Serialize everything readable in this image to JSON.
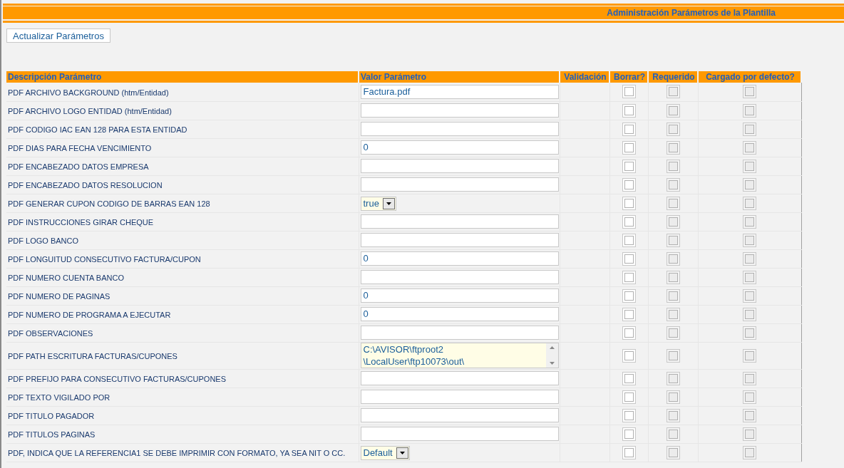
{
  "header": {
    "title": "Administración Parámetros de la Plantilla"
  },
  "update_button": {
    "label": "Actualizar Parámetros"
  },
  "table": {
    "columns": [
      "Descripción Parámetro",
      "Valor Parámetro",
      "Validación",
      "Borrar?",
      "Requerido",
      "Cargado por defecto?"
    ],
    "rows": [
      {
        "description": "PDF ARCHIVO BACKGROUND (htm/Entidad)",
        "kind": "text",
        "value": "Factura.pdf",
        "delete": {
          "checked": false,
          "disabled": false
        },
        "required": {
          "checked": false,
          "disabled": true
        },
        "default": {
          "checked": false,
          "disabled": true
        }
      },
      {
        "description": "PDF ARCHIVO LOGO ENTIDAD (htm/Entidad)",
        "kind": "text",
        "value": "",
        "delete": {
          "checked": false,
          "disabled": false
        },
        "required": {
          "checked": false,
          "disabled": true
        },
        "default": {
          "checked": false,
          "disabled": true
        }
      },
      {
        "description": "PDF CODIGO IAC EAN 128 PARA ESTA ENTIDAD",
        "kind": "text",
        "value": "",
        "delete": {
          "checked": false,
          "disabled": false
        },
        "required": {
          "checked": false,
          "disabled": true
        },
        "default": {
          "checked": false,
          "disabled": true
        }
      },
      {
        "description": "PDF DIAS PARA FECHA VENCIMIENTO",
        "kind": "text",
        "value": "0",
        "delete": {
          "checked": false,
          "disabled": false
        },
        "required": {
          "checked": false,
          "disabled": true
        },
        "default": {
          "checked": false,
          "disabled": true
        }
      },
      {
        "description": "PDF ENCABEZADO DATOS EMPRESA",
        "kind": "text",
        "value": "",
        "delete": {
          "checked": false,
          "disabled": false
        },
        "required": {
          "checked": false,
          "disabled": true
        },
        "default": {
          "checked": false,
          "disabled": true
        }
      },
      {
        "description": "PDF ENCABEZADO DATOS RESOLUCION",
        "kind": "text",
        "value": "",
        "delete": {
          "checked": false,
          "disabled": false
        },
        "required": {
          "checked": false,
          "disabled": true
        },
        "default": {
          "checked": false,
          "disabled": true
        }
      },
      {
        "description": "PDF GENERAR CUPON CODIGO DE BARRAS EAN 128",
        "kind": "select",
        "value": "true",
        "delete": {
          "checked": false,
          "disabled": false
        },
        "required": {
          "checked": false,
          "disabled": true
        },
        "default": {
          "checked": false,
          "disabled": true
        }
      },
      {
        "description": "PDF INSTRUCCIONES GIRAR CHEQUE",
        "kind": "text",
        "value": "",
        "delete": {
          "checked": false,
          "disabled": false
        },
        "required": {
          "checked": false,
          "disabled": true
        },
        "default": {
          "checked": false,
          "disabled": true
        }
      },
      {
        "description": "PDF LOGO BANCO",
        "kind": "text",
        "value": "",
        "delete": {
          "checked": false,
          "disabled": false
        },
        "required": {
          "checked": false,
          "disabled": true
        },
        "default": {
          "checked": false,
          "disabled": true
        }
      },
      {
        "description": "PDF LONGUITUD CONSECUTIVO FACTURA/CUPON",
        "kind": "text",
        "value": "0",
        "delete": {
          "checked": false,
          "disabled": false
        },
        "required": {
          "checked": false,
          "disabled": true
        },
        "default": {
          "checked": false,
          "disabled": true
        }
      },
      {
        "description": "PDF NUMERO CUENTA BANCO",
        "kind": "text",
        "value": "",
        "delete": {
          "checked": false,
          "disabled": false
        },
        "required": {
          "checked": false,
          "disabled": true
        },
        "default": {
          "checked": false,
          "disabled": true
        }
      },
      {
        "description": "PDF NUMERO DE PAGINAS",
        "kind": "text",
        "value": "0",
        "delete": {
          "checked": false,
          "disabled": false
        },
        "required": {
          "checked": false,
          "disabled": true
        },
        "default": {
          "checked": false,
          "disabled": true
        }
      },
      {
        "description": "PDF NUMERO DE PROGRAMA A EJECUTAR",
        "kind": "text",
        "value": "0",
        "delete": {
          "checked": false,
          "disabled": false
        },
        "required": {
          "checked": false,
          "disabled": true
        },
        "default": {
          "checked": false,
          "disabled": true
        }
      },
      {
        "description": "PDF OBSERVACIONES",
        "kind": "text",
        "value": "",
        "delete": {
          "checked": false,
          "disabled": false
        },
        "required": {
          "checked": false,
          "disabled": true
        },
        "default": {
          "checked": false,
          "disabled": true
        }
      },
      {
        "description": "PDF PATH ESCRITURA FACTURAS/CUPONES",
        "kind": "textarea",
        "value": "C:\\AVISOR\\ftproot2\n\\LocalUser\\ftp10073\\out\\",
        "delete": {
          "checked": false,
          "disabled": false
        },
        "required": {
          "checked": false,
          "disabled": true
        },
        "default": {
          "checked": false,
          "disabled": true
        }
      },
      {
        "description": "PDF PREFIJO PARA CONSECUTIVO FACTURAS/CUPONES",
        "kind": "text",
        "value": "",
        "delete": {
          "checked": false,
          "disabled": false
        },
        "required": {
          "checked": false,
          "disabled": true
        },
        "default": {
          "checked": false,
          "disabled": true
        }
      },
      {
        "description": "PDF TEXTO VIGILADO POR",
        "kind": "text",
        "value": "",
        "delete": {
          "checked": false,
          "disabled": false
        },
        "required": {
          "checked": false,
          "disabled": true
        },
        "default": {
          "checked": false,
          "disabled": true
        }
      },
      {
        "description": "PDF TITULO PAGADOR",
        "kind": "text",
        "value": "",
        "delete": {
          "checked": false,
          "disabled": false
        },
        "required": {
          "checked": false,
          "disabled": true
        },
        "default": {
          "checked": false,
          "disabled": true
        }
      },
      {
        "description": "PDF TITULOS PAGINAS",
        "kind": "text",
        "value": "",
        "delete": {
          "checked": false,
          "disabled": false
        },
        "required": {
          "checked": false,
          "disabled": true
        },
        "default": {
          "checked": false,
          "disabled": true
        }
      },
      {
        "description": "PDF, INDICA QUE LA REFERENCIA1 SE DEBE IMPRIMIR CON FORMATO, YA SEA NIT O CC.",
        "kind": "select",
        "value": "Default",
        "delete": {
          "checked": false,
          "disabled": false
        },
        "required": {
          "checked": false,
          "disabled": true
        },
        "default": {
          "checked": false,
          "disabled": true
        }
      }
    ]
  }
}
